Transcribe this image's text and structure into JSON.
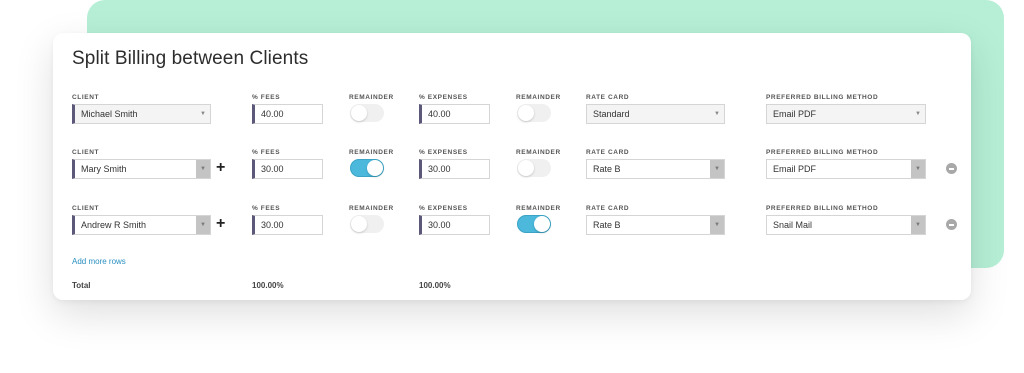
{
  "title": "Split Billing between Clients",
  "labels": {
    "client": "CLIENT",
    "fees": "% FEES",
    "remainder": "REMAINDER",
    "expenses": "% EXPENSES",
    "rate_card": "RATE CARD",
    "billing_method": "PREFERRED BILLING METHOD"
  },
  "rows": [
    {
      "client": "Michael Smith",
      "fees": "40.00",
      "fees_remainder": false,
      "expenses": "40.00",
      "expenses_remainder": false,
      "rate_card": "Standard",
      "billing_method": "Email PDF"
    },
    {
      "client": "Mary Smith",
      "fees": "30.00",
      "fees_remainder": true,
      "expenses": "30.00",
      "expenses_remainder": false,
      "rate_card": "Rate B",
      "billing_method": "Email PDF"
    },
    {
      "client": "Andrew R Smith",
      "fees": "30.00",
      "fees_remainder": false,
      "expenses": "30.00",
      "expenses_remainder": true,
      "rate_card": "Rate B",
      "billing_method": "Snail Mail"
    }
  ],
  "add_more_rows": "Add more rows",
  "total": {
    "label": "Total",
    "fees": "100.00%",
    "expenses": "100.00%"
  },
  "colors": {
    "accent_bar": "#5b587a",
    "toggle_on": "#4cb8dc",
    "link": "#2a8fc0",
    "backdrop": "#b6efd6"
  },
  "icons": {
    "caret": "chevron-down-icon",
    "add": "plus-icon",
    "remove": "minus-circle-icon"
  }
}
